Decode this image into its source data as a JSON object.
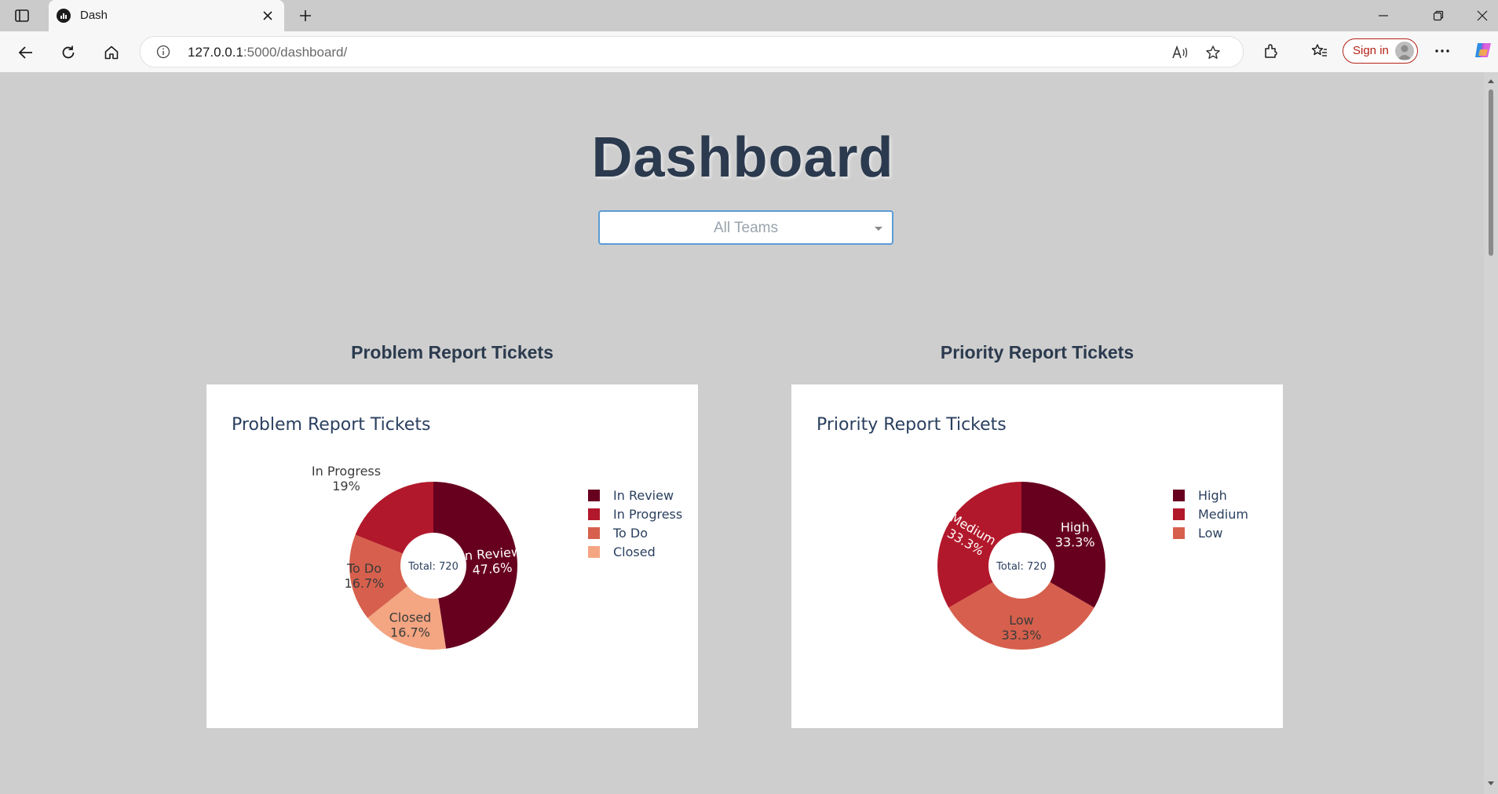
{
  "browser": {
    "tab_title": "Dash",
    "url_host": "127.0.0.1",
    "url_path": ":5000/dashboard/",
    "signin_label": "Sign in",
    "icons": [
      "sidebar-toggle-icon",
      "dash-favicon",
      "close-icon",
      "plus-icon",
      "minimize-icon",
      "restore-icon",
      "window-close-icon",
      "back-arrow-icon",
      "reload-icon",
      "home-icon",
      "info-icon",
      "read-aloud-icon",
      "favorite-star-icon",
      "extensions-icon",
      "favorites-icon",
      "avatar-icon",
      "more-icon",
      "copilot-icon"
    ]
  },
  "page": {
    "title": "Dashboard",
    "team_select": {
      "placeholder": "All Teams"
    },
    "sections": [
      {
        "heading": "Problem Report Tickets"
      },
      {
        "heading": "Priority Report Tickets"
      }
    ]
  },
  "chart_data": [
    {
      "type": "pie",
      "title": "Problem Report Tickets",
      "center_text": "Total: 720",
      "slices": [
        {
          "label": "In Review",
          "percent_label": "47.6%",
          "value": 47.6,
          "color": "#67001f"
        },
        {
          "label": "Closed",
          "percent_label": "16.7%",
          "value": 16.7,
          "color": "#f4a582"
        },
        {
          "label": "To Do",
          "percent_label": "16.7%",
          "value": 16.7,
          "color": "#d6604d"
        },
        {
          "label": "In Progress",
          "percent_label": "19%",
          "value": 19.0,
          "color": "#b2182b"
        }
      ],
      "legend": [
        {
          "label": "In Review",
          "color": "#67001f"
        },
        {
          "label": "In Progress",
          "color": "#b2182b"
        },
        {
          "label": "To Do",
          "color": "#d6604d"
        },
        {
          "label": "Closed",
          "color": "#f4a582"
        }
      ],
      "legend_position": "right"
    },
    {
      "type": "pie",
      "title": "Priority Report Tickets",
      "center_text": "Total: 720",
      "slices": [
        {
          "label": "High",
          "percent_label": "33.3%",
          "value": 33.3,
          "color": "#67001f"
        },
        {
          "label": "Low",
          "percent_label": "33.3%",
          "value": 33.3,
          "color": "#d6604d"
        },
        {
          "label": "Medium",
          "percent_label": "33.3%",
          "value": 33.3,
          "color": "#b2182b"
        }
      ],
      "legend": [
        {
          "label": "High",
          "color": "#67001f"
        },
        {
          "label": "Medium",
          "color": "#b2182b"
        },
        {
          "label": "Low",
          "color": "#d6604d"
        }
      ],
      "legend_position": "right"
    }
  ]
}
